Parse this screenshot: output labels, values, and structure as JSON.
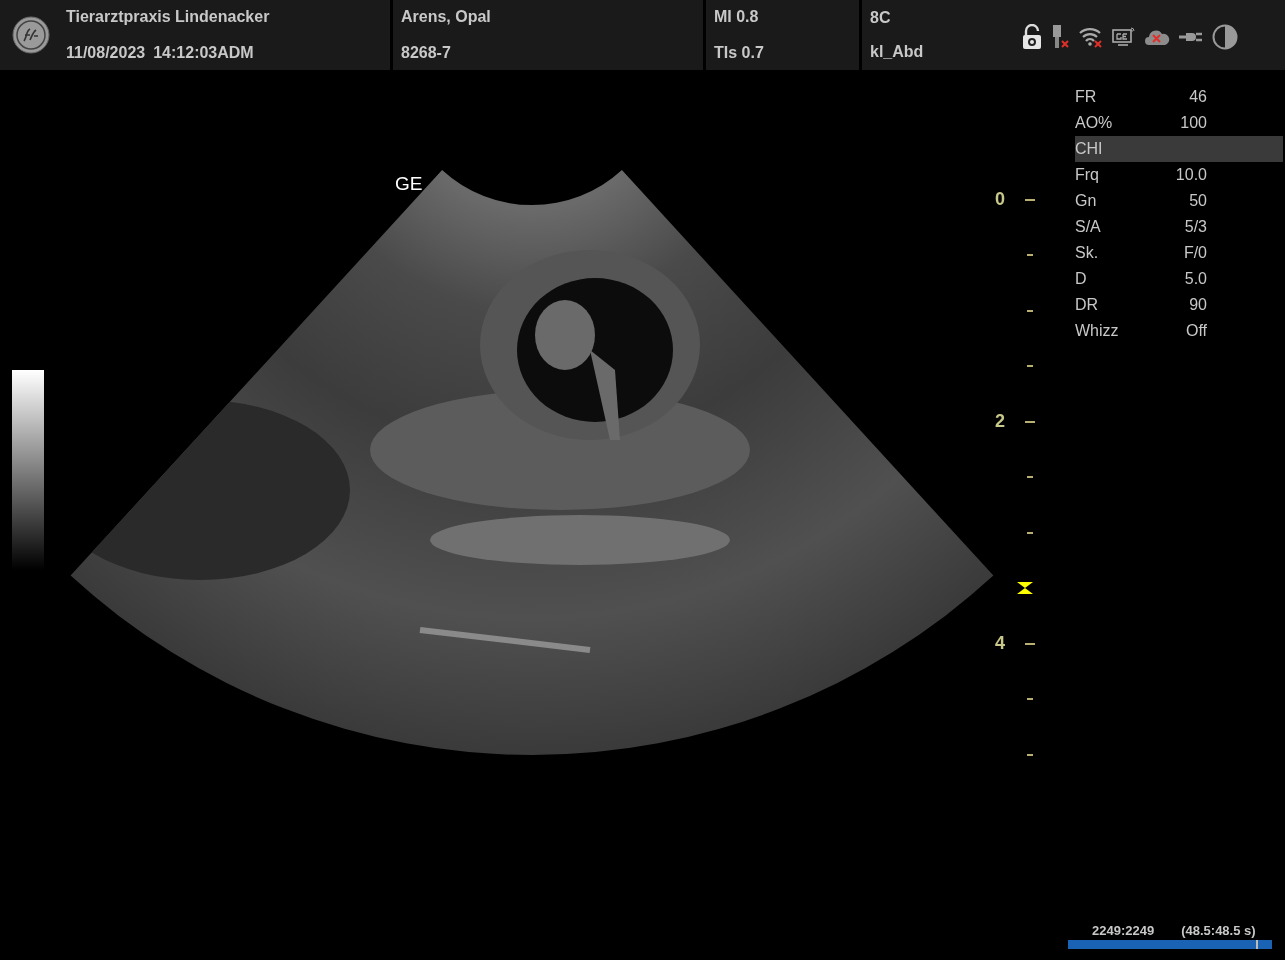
{
  "header": {
    "clinic": "Tierarztpraxis Lindenacker",
    "date": "11/08/2023",
    "time": "14:12:03",
    "operator": "ADM",
    "patient_name": "Arens, Opal",
    "patient_id": "8268-7",
    "mi": "MI 0.8",
    "tis": "TIs 0.7",
    "probe": "8C",
    "preset": "kl_Abd"
  },
  "image": {
    "label": "GE"
  },
  "depth_scale": {
    "labels": [
      "0",
      "2",
      "4"
    ]
  },
  "parameters": [
    {
      "label": "FR",
      "value": "46",
      "selected": false
    },
    {
      "label": "AO%",
      "value": "100",
      "selected": false
    },
    {
      "label": "CHI",
      "selected": true
    },
    {
      "label": "Frq",
      "value": "10.0",
      "selected": false
    },
    {
      "label": "Gn",
      "value": "50",
      "selected": false
    },
    {
      "label": "S/A",
      "value": "5/3",
      "selected": false
    },
    {
      "label": "Sk.",
      "value": "F/0",
      "selected": false
    },
    {
      "label": "D",
      "value": "5.0",
      "selected": false
    },
    {
      "label": "DR",
      "value": "90",
      "selected": false
    },
    {
      "label": "Whizz",
      "value": "Off",
      "selected": false
    }
  ],
  "cine": {
    "frames": "2249:2249",
    "seconds": "(48.5:48.5 s)",
    "level": 0.92
  }
}
